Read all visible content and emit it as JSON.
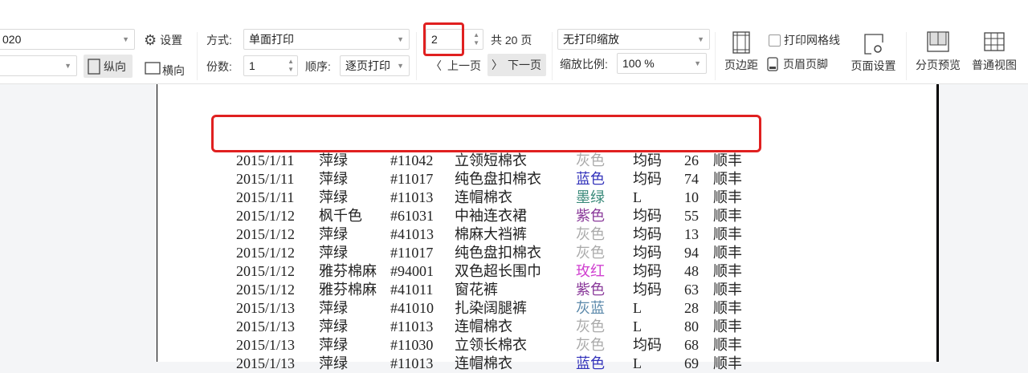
{
  "toolbar": {
    "printer_value": "020",
    "paper_value": "",
    "settings_label": "设置",
    "portrait_label": "纵向",
    "landscape_label": "横向",
    "mode_label": "方式:",
    "mode_value": "单面打印",
    "copies_label": "份数:",
    "copies_value": "1",
    "order_label": "顺序:",
    "order_value": "逐页打印",
    "page_value": "2",
    "total_pages": "共 20 页",
    "prev_label": "上一页",
    "next_label": "下一页",
    "scale_mode_value": "无打印缩放",
    "scale_label": "缩放比例:",
    "scale_value": "100 %",
    "margins_label": "页边距",
    "gridlines_label": "打印网格线",
    "gridlines_checked": false,
    "header_footer_label": "页眉页脚",
    "page_setup_label": "页面设置",
    "page_break_preview_label": "分页预览",
    "normal_view_label": "普通视图"
  },
  "colors": {
    "highlight": "#e02020",
    "page_bg": "#f4f5f7"
  },
  "rows": [
    {
      "date": "2015/1/11",
      "brand": "萍绿",
      "code": "#11042",
      "product": "立领短棉衣",
      "color": "灰色",
      "color_hex": "#aaaaaa",
      "size": "均码",
      "qty": "26",
      "ship": "顺丰"
    },
    {
      "date": "2015/1/11",
      "brand": "萍绿",
      "code": "#11017",
      "product": "纯色盘扣棉衣",
      "color": "蓝色",
      "color_hex": "#3333bb",
      "size": "均码",
      "qty": "74",
      "ship": "顺丰"
    },
    {
      "date": "2015/1/11",
      "brand": "萍绿",
      "code": "#11013",
      "product": "连帽棉衣",
      "color": "墨绿",
      "color_hex": "#3a8a7a",
      "size": "L",
      "qty": "10",
      "ship": "顺丰"
    },
    {
      "date": "2015/1/12",
      "brand": "枫千色",
      "code": "#61031",
      "product": "中袖连衣裙",
      "color": "紫色",
      "color_hex": "#8a3a9a",
      "size": "均码",
      "qty": "55",
      "ship": "顺丰"
    },
    {
      "date": "2015/1/12",
      "brand": "萍绿",
      "code": "#41013",
      "product": "棉麻大裆裤",
      "color": "灰色",
      "color_hex": "#aaaaaa",
      "size": "均码",
      "qty": "13",
      "ship": "顺丰"
    },
    {
      "date": "2015/1/12",
      "brand": "萍绿",
      "code": "#11017",
      "product": "纯色盘扣棉衣",
      "color": "灰色",
      "color_hex": "#aaaaaa",
      "size": "均码",
      "qty": "94",
      "ship": "顺丰"
    },
    {
      "date": "2015/1/12",
      "brand": "雅芬棉麻",
      "code": "#94001",
      "product": "双色超长围巾",
      "color": "玫红",
      "color_hex": "#d040d0",
      "size": "均码",
      "qty": "48",
      "ship": "顺丰"
    },
    {
      "date": "2015/1/12",
      "brand": "雅芬棉麻",
      "code": "#41011",
      "product": "窗花裤",
      "color": "紫色",
      "color_hex": "#8a3a9a",
      "size": "均码",
      "qty": "63",
      "ship": "顺丰"
    },
    {
      "date": "2015/1/13",
      "brand": "萍绿",
      "code": "#41010",
      "product": "扎染阔腿裤",
      "color": "灰蓝",
      "color_hex": "#5a88aa",
      "size": "L",
      "qty": "28",
      "ship": "顺丰"
    },
    {
      "date": "2015/1/13",
      "brand": "萍绿",
      "code": "#11013",
      "product": "连帽棉衣",
      "color": "灰色",
      "color_hex": "#aaaaaa",
      "size": "L",
      "qty": "80",
      "ship": "顺丰"
    },
    {
      "date": "2015/1/13",
      "brand": "萍绿",
      "code": "#11030",
      "product": "立领长棉衣",
      "color": "灰色",
      "color_hex": "#aaaaaa",
      "size": "均码",
      "qty": "68",
      "ship": "顺丰"
    },
    {
      "date": "2015/1/13",
      "brand": "萍绿",
      "code": "#11013",
      "product": "连帽棉衣",
      "color": "蓝色",
      "color_hex": "#3333bb",
      "size": "L",
      "qty": "69",
      "ship": "顺丰"
    }
  ]
}
